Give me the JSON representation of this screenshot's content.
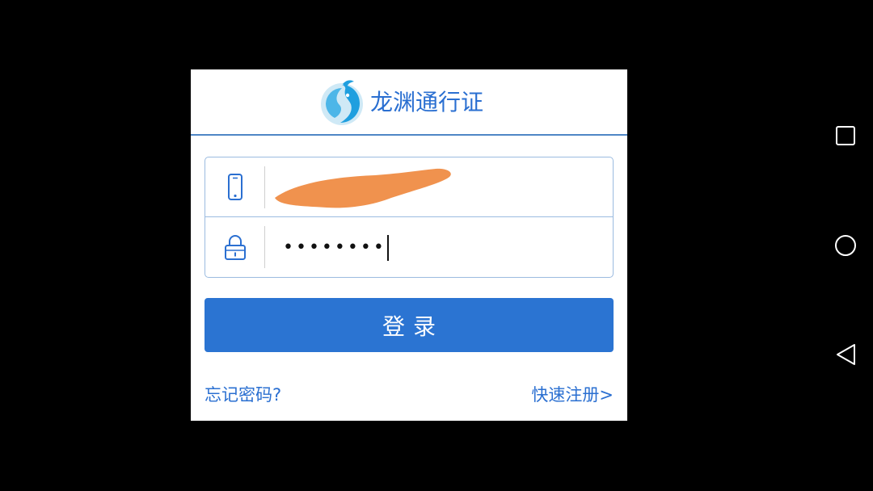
{
  "header": {
    "title": "龙渊通行证",
    "logo_icon": "dragon-logo-icon"
  },
  "form": {
    "phone": {
      "icon": "phone-icon",
      "value_redacted": true
    },
    "password": {
      "icon": "lock-icon",
      "masked_value": "••••••••"
    }
  },
  "login_button": {
    "label": "登录"
  },
  "links": {
    "forgot_password": "忘记密码?",
    "quick_register": "快速注册>"
  },
  "navbar": {
    "recents_icon": "square-recents-icon",
    "home_icon": "circle-home-icon",
    "back_icon": "triangle-back-icon"
  },
  "colors": {
    "accent": "#2b74d2",
    "link": "#2a6fd1",
    "border": "#9bbbe0",
    "redaction": "#f0924e",
    "background": "#000000"
  }
}
